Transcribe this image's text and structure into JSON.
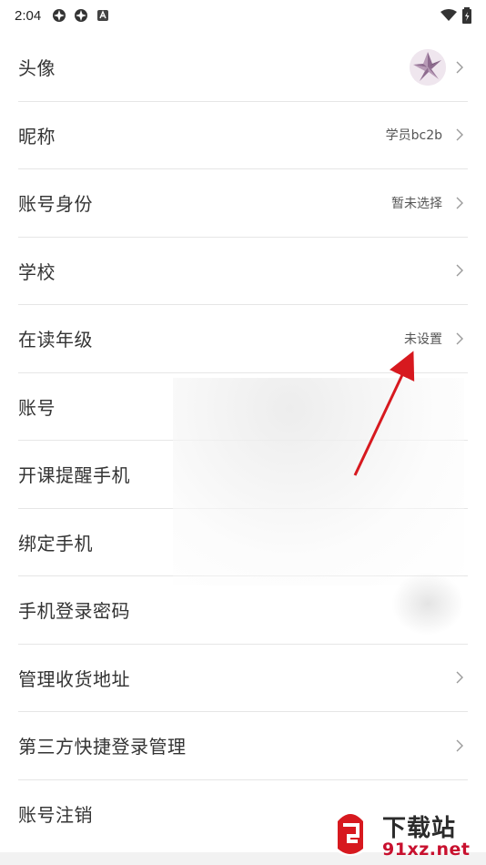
{
  "status_bar": {
    "time": "2:04"
  },
  "settings": {
    "items": [
      {
        "label": "头像",
        "value": "",
        "has_avatar": true
      },
      {
        "label": "昵称",
        "value": "学员bc2b"
      },
      {
        "label": "账号身份",
        "value": "暂未选择"
      },
      {
        "label": "学校",
        "value": ""
      },
      {
        "label": "在读年级",
        "value": "未设置"
      },
      {
        "label": "账号",
        "value": ""
      },
      {
        "label": "开课提醒手机",
        "value": ""
      },
      {
        "label": "绑定手机",
        "value": ""
      },
      {
        "label": "手机登录密码",
        "value": ""
      },
      {
        "label": "管理收货地址",
        "value": ""
      },
      {
        "label": "第三方快捷登录管理",
        "value": ""
      },
      {
        "label": "账号注销",
        "value": ""
      }
    ]
  },
  "watermark": {
    "logo_text": "下载站",
    "url": "91xz.net"
  },
  "colors": {
    "divider": "#e6e6e6",
    "arrow": "#d7191f",
    "avatar": "#8e6b8f"
  }
}
